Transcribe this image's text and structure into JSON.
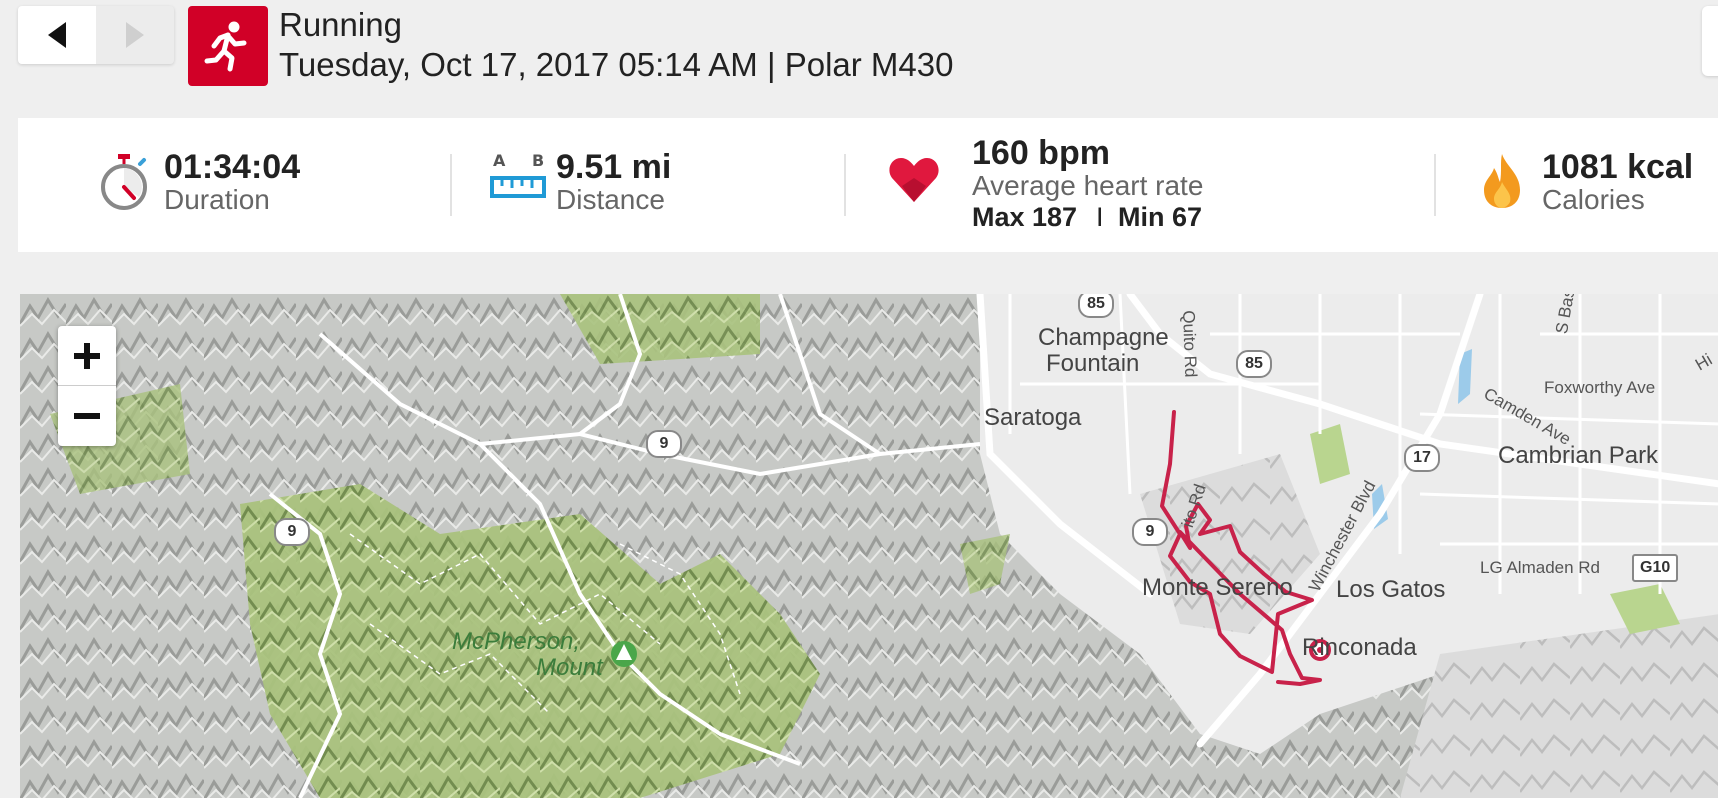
{
  "header": {
    "sport": "Running",
    "subtitle": "Tuesday, Oct 17, 2017 05:14 AM | Polar M430",
    "prev_icon": "chevron-left-icon",
    "next_icon": "chevron-right-icon",
    "sport_icon": "runner-icon",
    "sport_color": "#d10027"
  },
  "summary": {
    "duration": {
      "value": "01:34:04",
      "label": "Duration",
      "icon": "stopwatch-icon"
    },
    "distance": {
      "value": "9.51 mi",
      "label": "Distance",
      "icon": "ruler-ab-icon",
      "a_label": "A",
      "b_label": "B"
    },
    "heart_rate": {
      "value": "160 bpm",
      "label": "Average heart rate",
      "max": "Max 187",
      "sep": "I",
      "min": "Min 67",
      "icon": "heart-icon"
    },
    "calories": {
      "value": "1081 kcal",
      "label": "Calories",
      "icon": "flame-icon"
    }
  },
  "map": {
    "zoom_in": "+",
    "zoom_out": "−",
    "route_color": "#c8224a",
    "labels": {
      "champagne1": "Champagne",
      "champagne2": "Fountain",
      "saratoga": "Saratoga",
      "quito_rd": "Quito Rd",
      "quito_rd2": "ito Rd",
      "winchester": "Winchester Blvd",
      "foxworthy": "Foxworthy Ave",
      "camden": "Camden Ave",
      "cambrian": "Cambrian Park",
      "s_bas": "S Bas",
      "hi": "Hi",
      "lg_almaden": "LG Almaden Rd",
      "monte_sereno": "Monte Sereno",
      "los_gatos": "Los Gatos",
      "rinconada": "Rinconada",
      "mcpherson1": "McPherson,",
      "mcpherson2": "Mount"
    },
    "shields": {
      "r85a": "85",
      "r85b": "85",
      "r9a": "9",
      "r9b": "9",
      "r9c": "9",
      "r17": "17",
      "g10": "G10"
    }
  }
}
